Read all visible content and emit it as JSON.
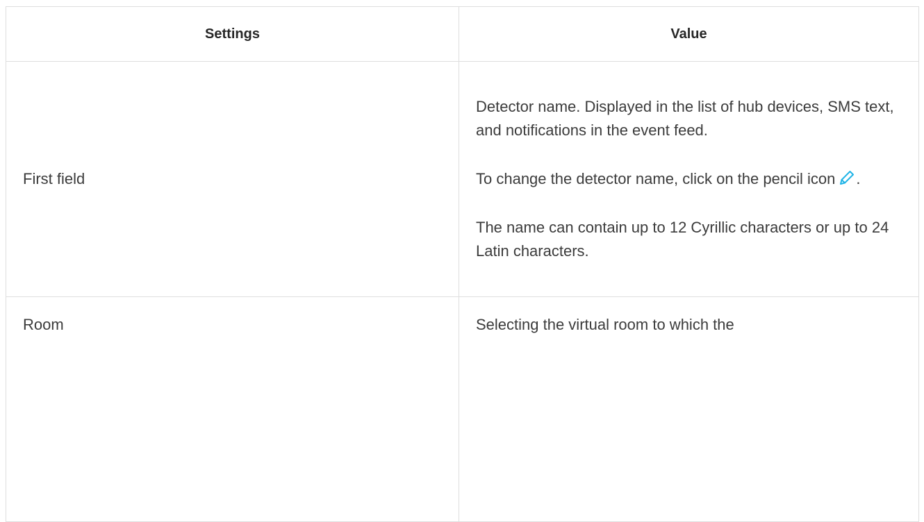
{
  "table": {
    "headers": {
      "settings": "Settings",
      "value": "Value"
    },
    "rows": [
      {
        "setting": "First field",
        "value_paragraphs": [
          "Detector name. Displayed in the list of hub devices, SMS text, and notifications in the event feed.",
          "To change the detector name, click on the pencil icon",
          "The name can contain up to 12 Cyrillic characters or up to 24 Latin characters."
        ],
        "after_icon_text": "."
      },
      {
        "setting": "Room",
        "value_paragraphs": [
          "Selecting the virtual room to which the"
        ]
      }
    ]
  },
  "icons": {
    "pencil": "pencil-icon"
  },
  "colors": {
    "icon_accent": "#1eb3e6",
    "border": "#dedede",
    "text": "#3b3b3b",
    "header_text": "#262626"
  }
}
